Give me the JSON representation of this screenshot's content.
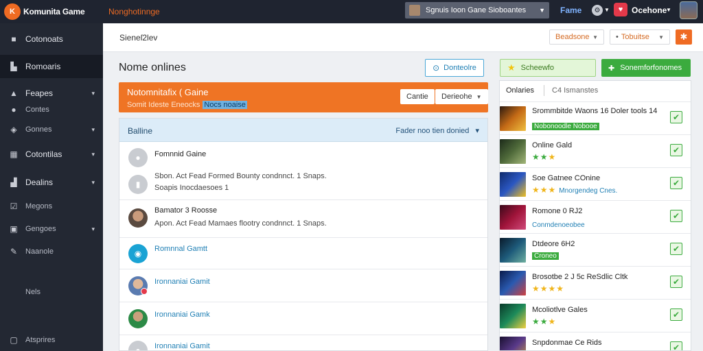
{
  "topbar": {
    "logo_mark": "K",
    "logo_text": "Komunita Game",
    "nav_link": "Nonghotinnge",
    "search_text": "Sgnuis Ioon Gane Sioboantes",
    "game_link": "Fame",
    "user_name": "Ocehone"
  },
  "sidebar": {
    "items": [
      {
        "label": "Cotonoats"
      },
      {
        "label": "Romoaris"
      },
      {
        "label": "Feapes"
      },
      {
        "label": "Contes"
      },
      {
        "label": "Gonnes"
      },
      {
        "label": "Cotontilas"
      },
      {
        "label": "Dealins"
      },
      {
        "label": "Megons"
      },
      {
        "label": "Gengoes"
      },
      {
        "label": "Naanole"
      },
      {
        "label": "Nels"
      },
      {
        "label": "Atsprires"
      }
    ]
  },
  "header": {
    "breadcrumb": "Sieneſ2lev",
    "dropdown1": "Beadsone",
    "dropdown2": "Tobuitse"
  },
  "main": {
    "title": "Nome onlines",
    "outline_button": "Donteolre",
    "banner": {
      "title": "Notomnitafix ( Gaine",
      "subtitle": "Somit Ideste Eneocks",
      "subtitle_link": "Nocs noaise",
      "button1": "Cantie",
      "button2": "Derieohe"
    },
    "list": {
      "header_title": "Balline",
      "header_right": "Fader noo tien donied",
      "rows": [
        {
          "name": "Fomnnid Gaine",
          "line1": "Sbon. Act Fead Formed Bounty condnnct. 1 Snaps.",
          "line2": "Soapis Inocdaesoes 1"
        },
        {
          "name": "Bamator 3 Roosse",
          "line1": "Apon. Act Fead Mamaes flootry condnnct. 1 Snaps."
        },
        {
          "name": "Romnnal Gamtt"
        },
        {
          "name": "Ironnaniai Gamit"
        },
        {
          "name": "Ironnaniai Gamk"
        },
        {
          "name": "Ironnaniai Gamit"
        }
      ]
    }
  },
  "right": {
    "button_light": "Scheewfo",
    "button_green": "Sonemforfonomes",
    "tabs": {
      "active": "Onlaries",
      "inactive": "C4 Ismanstes"
    },
    "games": [
      {
        "title": "Srommbitde Waons 16 Doler tools 14",
        "sub": "Nobonoodle Nobooe"
      },
      {
        "title": "Online Gald",
        "stars": 3
      },
      {
        "title": "Soe Gatnee COnine",
        "stars": 3,
        "sub": "Mnorgendeg Cnes."
      },
      {
        "title": "Romone 0 RJ2",
        "sub": "Conmdenoeobee"
      },
      {
        "title": "Dtdeore 6H2",
        "sub": "Croneo"
      },
      {
        "title": "Brosotbe 2 J 5c ReSdlic Cltk",
        "stars": 4
      },
      {
        "title": "Mcoliotlve Gales",
        "stars": 3
      },
      {
        "title": "Snpdonmae Ce Rids"
      }
    ]
  },
  "colors": {
    "accent": "#ef6b23",
    "green": "#3bab3e",
    "link": "#1f7fb4",
    "sidebar": "#232833"
  }
}
